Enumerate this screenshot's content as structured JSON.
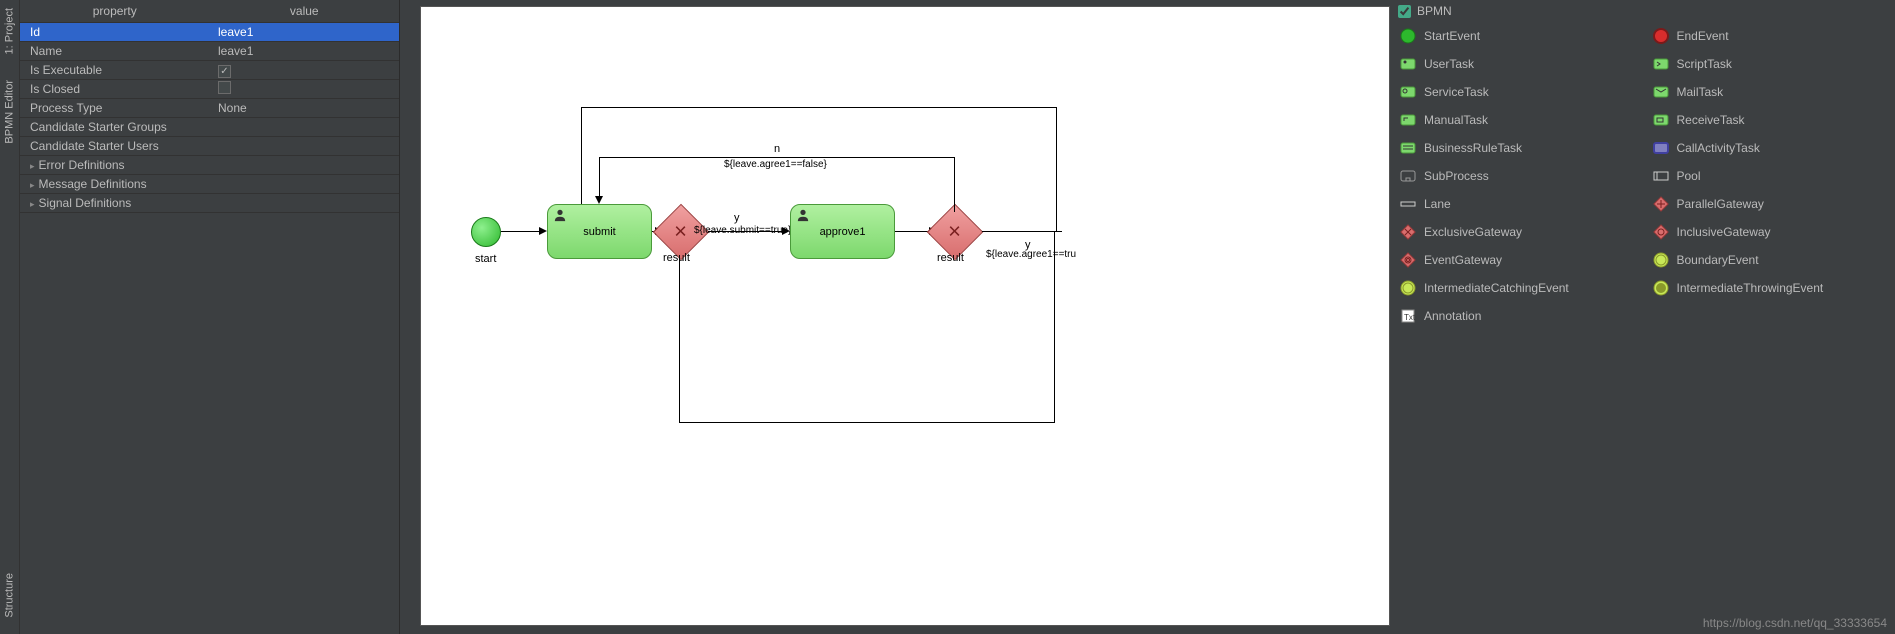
{
  "side_tabs": {
    "project": "1: Project",
    "bpmn_editor": "BPMN Editor",
    "structure": "Structure"
  },
  "properties": {
    "header_key": "property",
    "header_val": "value",
    "rows": [
      {
        "key": "Id",
        "val": "leave1",
        "selected": true
      },
      {
        "key": "Name",
        "val": "leave1"
      },
      {
        "key": "Is Executable",
        "val": "",
        "checkbox": true,
        "checked": true
      },
      {
        "key": "Is Closed",
        "val": "",
        "checkbox": true,
        "checked": false
      },
      {
        "key": "Process Type",
        "val": "None"
      },
      {
        "key": "Candidate Starter Groups",
        "val": ""
      },
      {
        "key": "Candidate Starter Users",
        "val": ""
      },
      {
        "key": "Error Definitions",
        "val": "",
        "expandable": true
      },
      {
        "key": "Message Definitions",
        "val": "",
        "expandable": true
      },
      {
        "key": "Signal Definitions",
        "val": "",
        "expandable": true
      }
    ]
  },
  "diagram": {
    "start_label": "start",
    "task1_label": "submit",
    "gateway1_label": "result",
    "task2_label": "approve1",
    "gateway2_label": "result",
    "flow_y1": "y",
    "flow_y1_cond": "${leave.submit==true}",
    "flow_n": "n",
    "flow_n_cond": "${leave.agree1==false}",
    "flow_y2": "y",
    "flow_y2_cond": "${leave.agree1==tru"
  },
  "palette": {
    "title": "BPMN",
    "items_left": [
      {
        "label": "StartEvent",
        "icon": "start-event-icon",
        "color": "#2db82d"
      },
      {
        "label": "UserTask",
        "icon": "user-task-icon",
        "color": "#7dd86d"
      },
      {
        "label": "ServiceTask",
        "icon": "service-task-icon",
        "color": "#7dd86d"
      },
      {
        "label": "ManualTask",
        "icon": "manual-task-icon",
        "color": "#7dd86d"
      },
      {
        "label": "BusinessRuleTask",
        "icon": "business-rule-task-icon",
        "color": "#7dd86d"
      },
      {
        "label": "SubProcess",
        "icon": "subprocess-icon",
        "color": "#999"
      },
      {
        "label": "Lane",
        "icon": "lane-icon",
        "color": "#ccc"
      },
      {
        "label": "ExclusiveGateway",
        "icon": "exclusive-gateway-icon",
        "color": "#d86d6d"
      },
      {
        "label": "EventGateway",
        "icon": "event-gateway-icon",
        "color": "#d86d6d"
      },
      {
        "label": "IntermediateCatchingEvent",
        "icon": "intermediate-catching-icon",
        "color": "#c8e858"
      },
      {
        "label": "Annotation",
        "icon": "annotation-icon",
        "color": "#fff"
      }
    ],
    "items_right": [
      {
        "label": "EndEvent",
        "icon": "end-event-icon",
        "color": "#d82d2d"
      },
      {
        "label": "ScriptTask",
        "icon": "script-task-icon",
        "color": "#7dd86d"
      },
      {
        "label": "MailTask",
        "icon": "mail-task-icon",
        "color": "#7dd86d"
      },
      {
        "label": "ReceiveTask",
        "icon": "receive-task-icon",
        "color": "#7dd86d"
      },
      {
        "label": "CallActivityTask",
        "icon": "call-activity-icon",
        "color": "#8080c0"
      },
      {
        "label": "Pool",
        "icon": "pool-icon",
        "color": "#ccc"
      },
      {
        "label": "ParallelGateway",
        "icon": "parallel-gateway-icon",
        "color": "#d86d6d"
      },
      {
        "label": "InclusiveGateway",
        "icon": "inclusive-gateway-icon",
        "color": "#d86d6d"
      },
      {
        "label": "BoundaryEvent",
        "icon": "boundary-event-icon",
        "color": "#c8e858"
      },
      {
        "label": "IntermediateThrowingEvent",
        "icon": "intermediate-throwing-icon",
        "color": "#c8e858"
      }
    ]
  },
  "watermark": "https://blog.csdn.net/qq_33333654"
}
